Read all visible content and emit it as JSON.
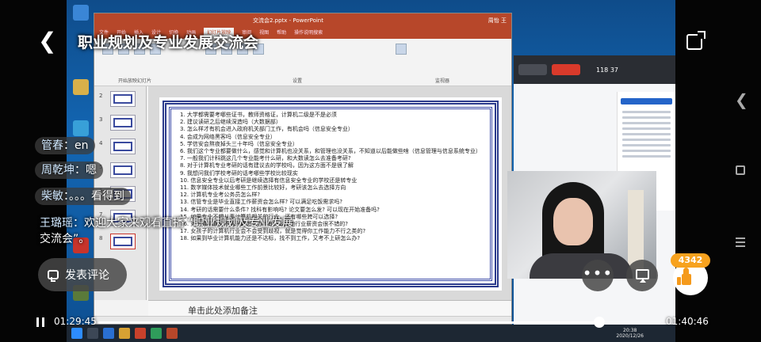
{
  "header": {
    "title": "职业规划及专业发展交流会"
  },
  "screen_share": {
    "ppt_window_title": "交流会2.pptx - PowerPoint",
    "ppt_user": "周怡 王",
    "ppt_tabs": [
      "文件",
      "开始",
      "插入",
      "设计",
      "切换",
      "动画",
      "幻灯片放映",
      "审阅",
      "视图",
      "帮助",
      "操作说明搜索"
    ],
    "ppt_active_tab": "幻灯片放映",
    "ribbon_groups": [
      "开始放映幻灯片",
      "设置",
      "监视器"
    ],
    "slide_items": [
      "1. 大学都需要考哪些证书，教师资格证，计算机二级是不是必须",
      "2. 建议读研之后继续深造吗（大数据部）",
      "3. 怎么样才有机会进入政府机关部门工作，有机会吗（信息安全专业）",
      "4. 会成为网络黑客吗（信息安全专业）",
      "5. 学信安会熬夜掉头三十年吗（信息安全专业）",
      "6. 我们这个专业都要做什么，感觉和计算机也没关系，和管理也没关系，不知道以后能做些啥（信息管理与信息系统专业）",
      "7. 一般我们计科跳这几个专业能考什么研，和大数读怎么去准备考研?",
      "8. 对于计算机专业考研的话有建议去的学校吗，因为这方面不是很了解",
      "9. 我想问我们学校考研的话考哪些学校比较现实",
      "10. 信息安全专业以后考研是继续选择有信息安全专业的学校还是转专业",
      "11. 数字媒体技术就业哪些工作前景比较好，考研该怎么去选择方向",
      "12. 计算机专业考公务员怎么样?",
      "13. 信管专业是毕业直接工作薪资会怎么样? 可以满足吃饭需求吗?",
      "14. 考研的话需要什么条件? 找科有影响吗? 论文要怎么发? 可以现在开始准备吗?",
      "15. 如果专业不想从事计算机相关的行业，还有哪些跨可以选择?",
      "16. 对计算机真的不感兴趣怎么办? 有什么其他行业薪资会很不错的?",
      "17. 女孩子的计算机行业会不会受到歧视，就是觉得你工作能力不行之类的?",
      "18. 如果到毕业计算机能力还是不达标，找不到工作，又考不上研怎么办?"
    ],
    "notes_placeholder": "单击此处添加备注",
    "meeting_numbers": "118   37",
    "taskbar_clock": "20:38\n2020/12/26"
  },
  "comments": [
    {
      "user": "管春",
      "sep": "：",
      "text": "en"
    },
    {
      "user": "周乾坤",
      "sep": "：",
      "text": "嗯"
    },
    {
      "user": "柴敏",
      "sep": "：",
      "text": "。。。看得到"
    }
  ],
  "announcement": {
    "user": "王璐瑶",
    "text": "：欢迎大家来观看直播 “职业规划及专业发展交流会”。"
  },
  "comment_button": {
    "label": "发表评论"
  },
  "more_button": {
    "label": "•••"
  },
  "likes": {
    "count": "4342"
  },
  "player": {
    "current_time": "01:29:45",
    "total_time": "01:40:46",
    "progress": 0.8906,
    "accent_color": "#f7a21e"
  }
}
